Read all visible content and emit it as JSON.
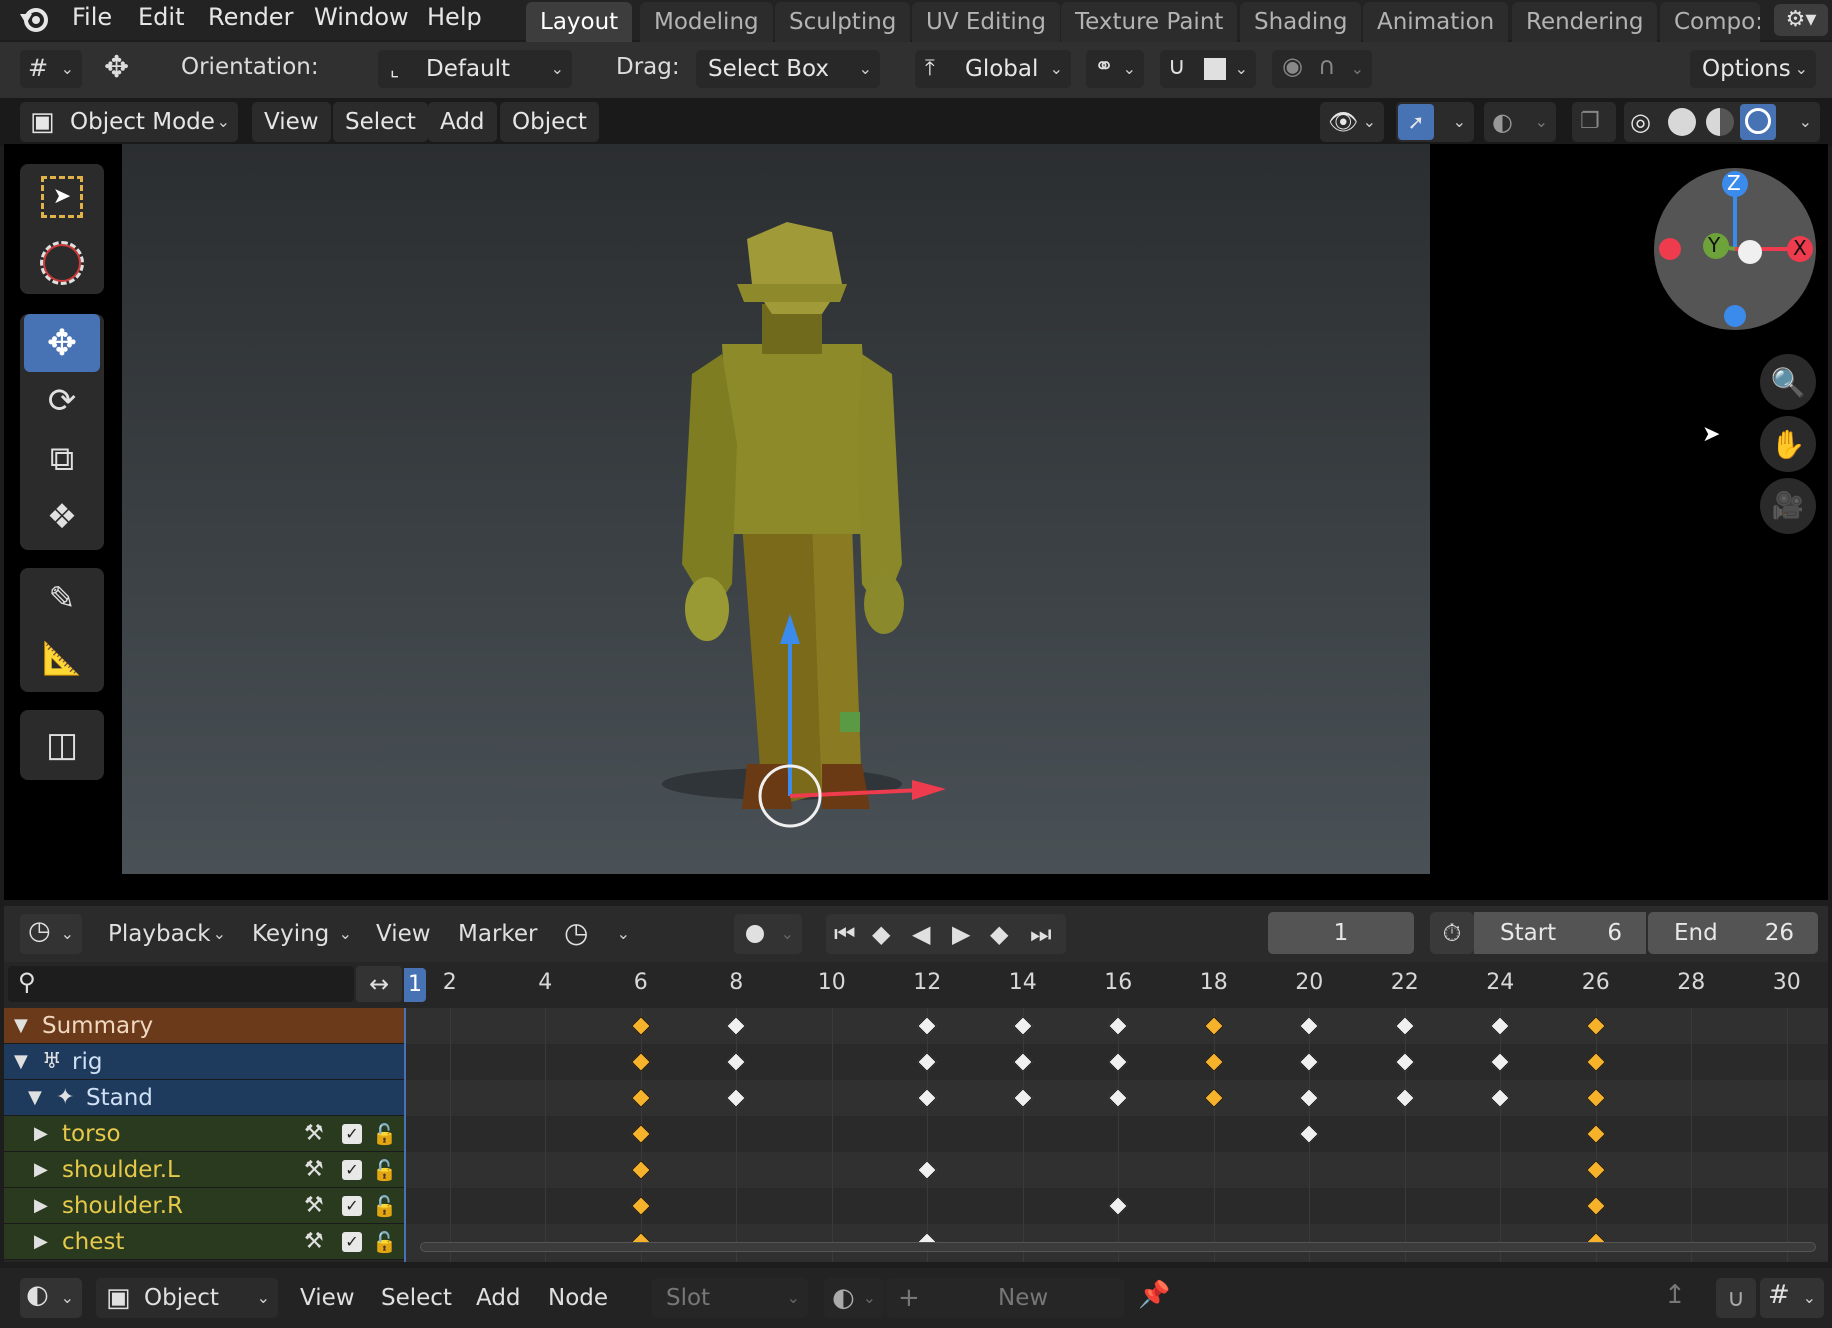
{
  "menu": {
    "items": [
      "File",
      "Edit",
      "Render",
      "Window",
      "Help"
    ]
  },
  "workspaces": {
    "tabs": [
      "Layout",
      "Modeling",
      "Sculpting",
      "UV Editing",
      "Texture Paint",
      "Shading",
      "Animation",
      "Rendering",
      "Compo:"
    ],
    "active": "Layout"
  },
  "tool_settings": {
    "orientation_label": "Orientation:",
    "orientation_value": "Default",
    "drag_label": "Drag:",
    "drag_value": "Select Box",
    "transform_orientation": "Global",
    "options_label": "Options"
  },
  "viewport_header": {
    "mode": "Object Mode",
    "menus": [
      "View",
      "Select",
      "Add",
      "Object"
    ]
  },
  "gizmo": {
    "axes": [
      "Z",
      "Y",
      "X"
    ]
  },
  "timeline": {
    "menus": [
      "Playback",
      "Keying",
      "View",
      "Marker"
    ],
    "current_frame": "1",
    "start_label": "Start",
    "start_value": "6",
    "end_label": "End",
    "end_value": "26",
    "ruler": [
      "1",
      "2",
      "4",
      "6",
      "8",
      "10",
      "12",
      "14",
      "16",
      "18",
      "20",
      "22",
      "24",
      "26",
      "28",
      "30"
    ]
  },
  "channels": [
    {
      "label": "Summary",
      "kind": "summary"
    },
    {
      "label": "rig",
      "kind": "object"
    },
    {
      "label": "Stand",
      "kind": "action"
    },
    {
      "label": "torso",
      "kind": "bone"
    },
    {
      "label": "shoulder.L",
      "kind": "bone"
    },
    {
      "label": "shoulder.R",
      "kind": "bone"
    },
    {
      "label": "chest",
      "kind": "bone"
    }
  ],
  "keyframes": [
    {
      "row": 0,
      "frames": [
        6,
        8,
        12,
        14,
        16,
        18,
        20,
        22,
        24,
        26
      ],
      "selected": [
        6,
        18,
        26
      ]
    },
    {
      "row": 1,
      "frames": [
        6,
        8,
        12,
        14,
        16,
        18,
        20,
        22,
        24,
        26
      ],
      "selected": [
        6,
        18,
        26
      ]
    },
    {
      "row": 2,
      "frames": [
        6,
        8,
        12,
        14,
        16,
        18,
        20,
        22,
        24,
        26
      ],
      "selected": [
        6,
        18,
        26
      ]
    },
    {
      "row": 3,
      "frames": [
        6,
        20,
        26
      ],
      "selected": [
        6,
        26
      ]
    },
    {
      "row": 4,
      "frames": [
        6,
        12,
        26
      ],
      "selected": [
        6,
        26
      ]
    },
    {
      "row": 5,
      "frames": [
        6,
        16,
        26
      ],
      "selected": [
        6,
        26
      ]
    },
    {
      "row": 6,
      "frames": [
        6,
        12,
        26
      ],
      "selected": [
        6,
        26
      ]
    }
  ],
  "bottom_header": {
    "object_label": "Object",
    "menus": [
      "View",
      "Select",
      "Add",
      "Node"
    ],
    "slot_label": "Slot",
    "new_label": "New"
  },
  "colors": {
    "accent": "#4772b3",
    "keyframe_selected": "#f5b22a",
    "keyframe_unselected": "#f0f0f0",
    "summary_bg": "#6b3a1a",
    "object_bg": "#1e3a5c",
    "bone_bg": "#2a3a1e",
    "bone_text": "#e6c94a"
  }
}
